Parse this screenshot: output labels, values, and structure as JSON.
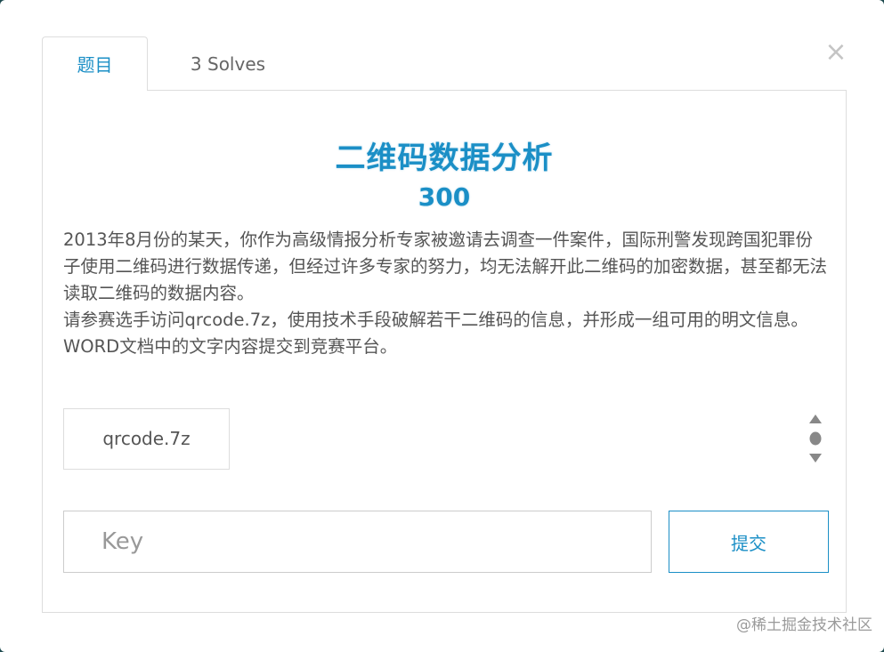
{
  "dialog": {
    "close_label": "×"
  },
  "tabs": [
    {
      "label": "题目",
      "active": true
    },
    {
      "label": "3 Solves",
      "active": false
    }
  ],
  "challenge": {
    "title": "二维码数据分析",
    "points": "300",
    "description": [
      "2013年8月份的某天，你作为高级情报分析专家被邀请去调查一件案件，国际刑警发现跨国犯罪份子使用二维码进行数据传递，但经过许多专家的努力，均无法解开此二维码的加密数据，甚至都无法读取二维码的数据内容。",
      "请参赛选手访问qrcode.7z，使用技术手段破解若干二维码的信息，并形成一组可用的明文信息。",
      "WORD文档中的文字内容提交到竞赛平台。"
    ],
    "file_name": "qrcode.7z"
  },
  "submission": {
    "key_value": "",
    "key_placeholder": "Key",
    "submit_label": "提交"
  },
  "watermark": "@稀土掘金技术社区",
  "colors": {
    "accent": "#1b8fc6",
    "text": "#555555",
    "border": "#dddddd"
  }
}
